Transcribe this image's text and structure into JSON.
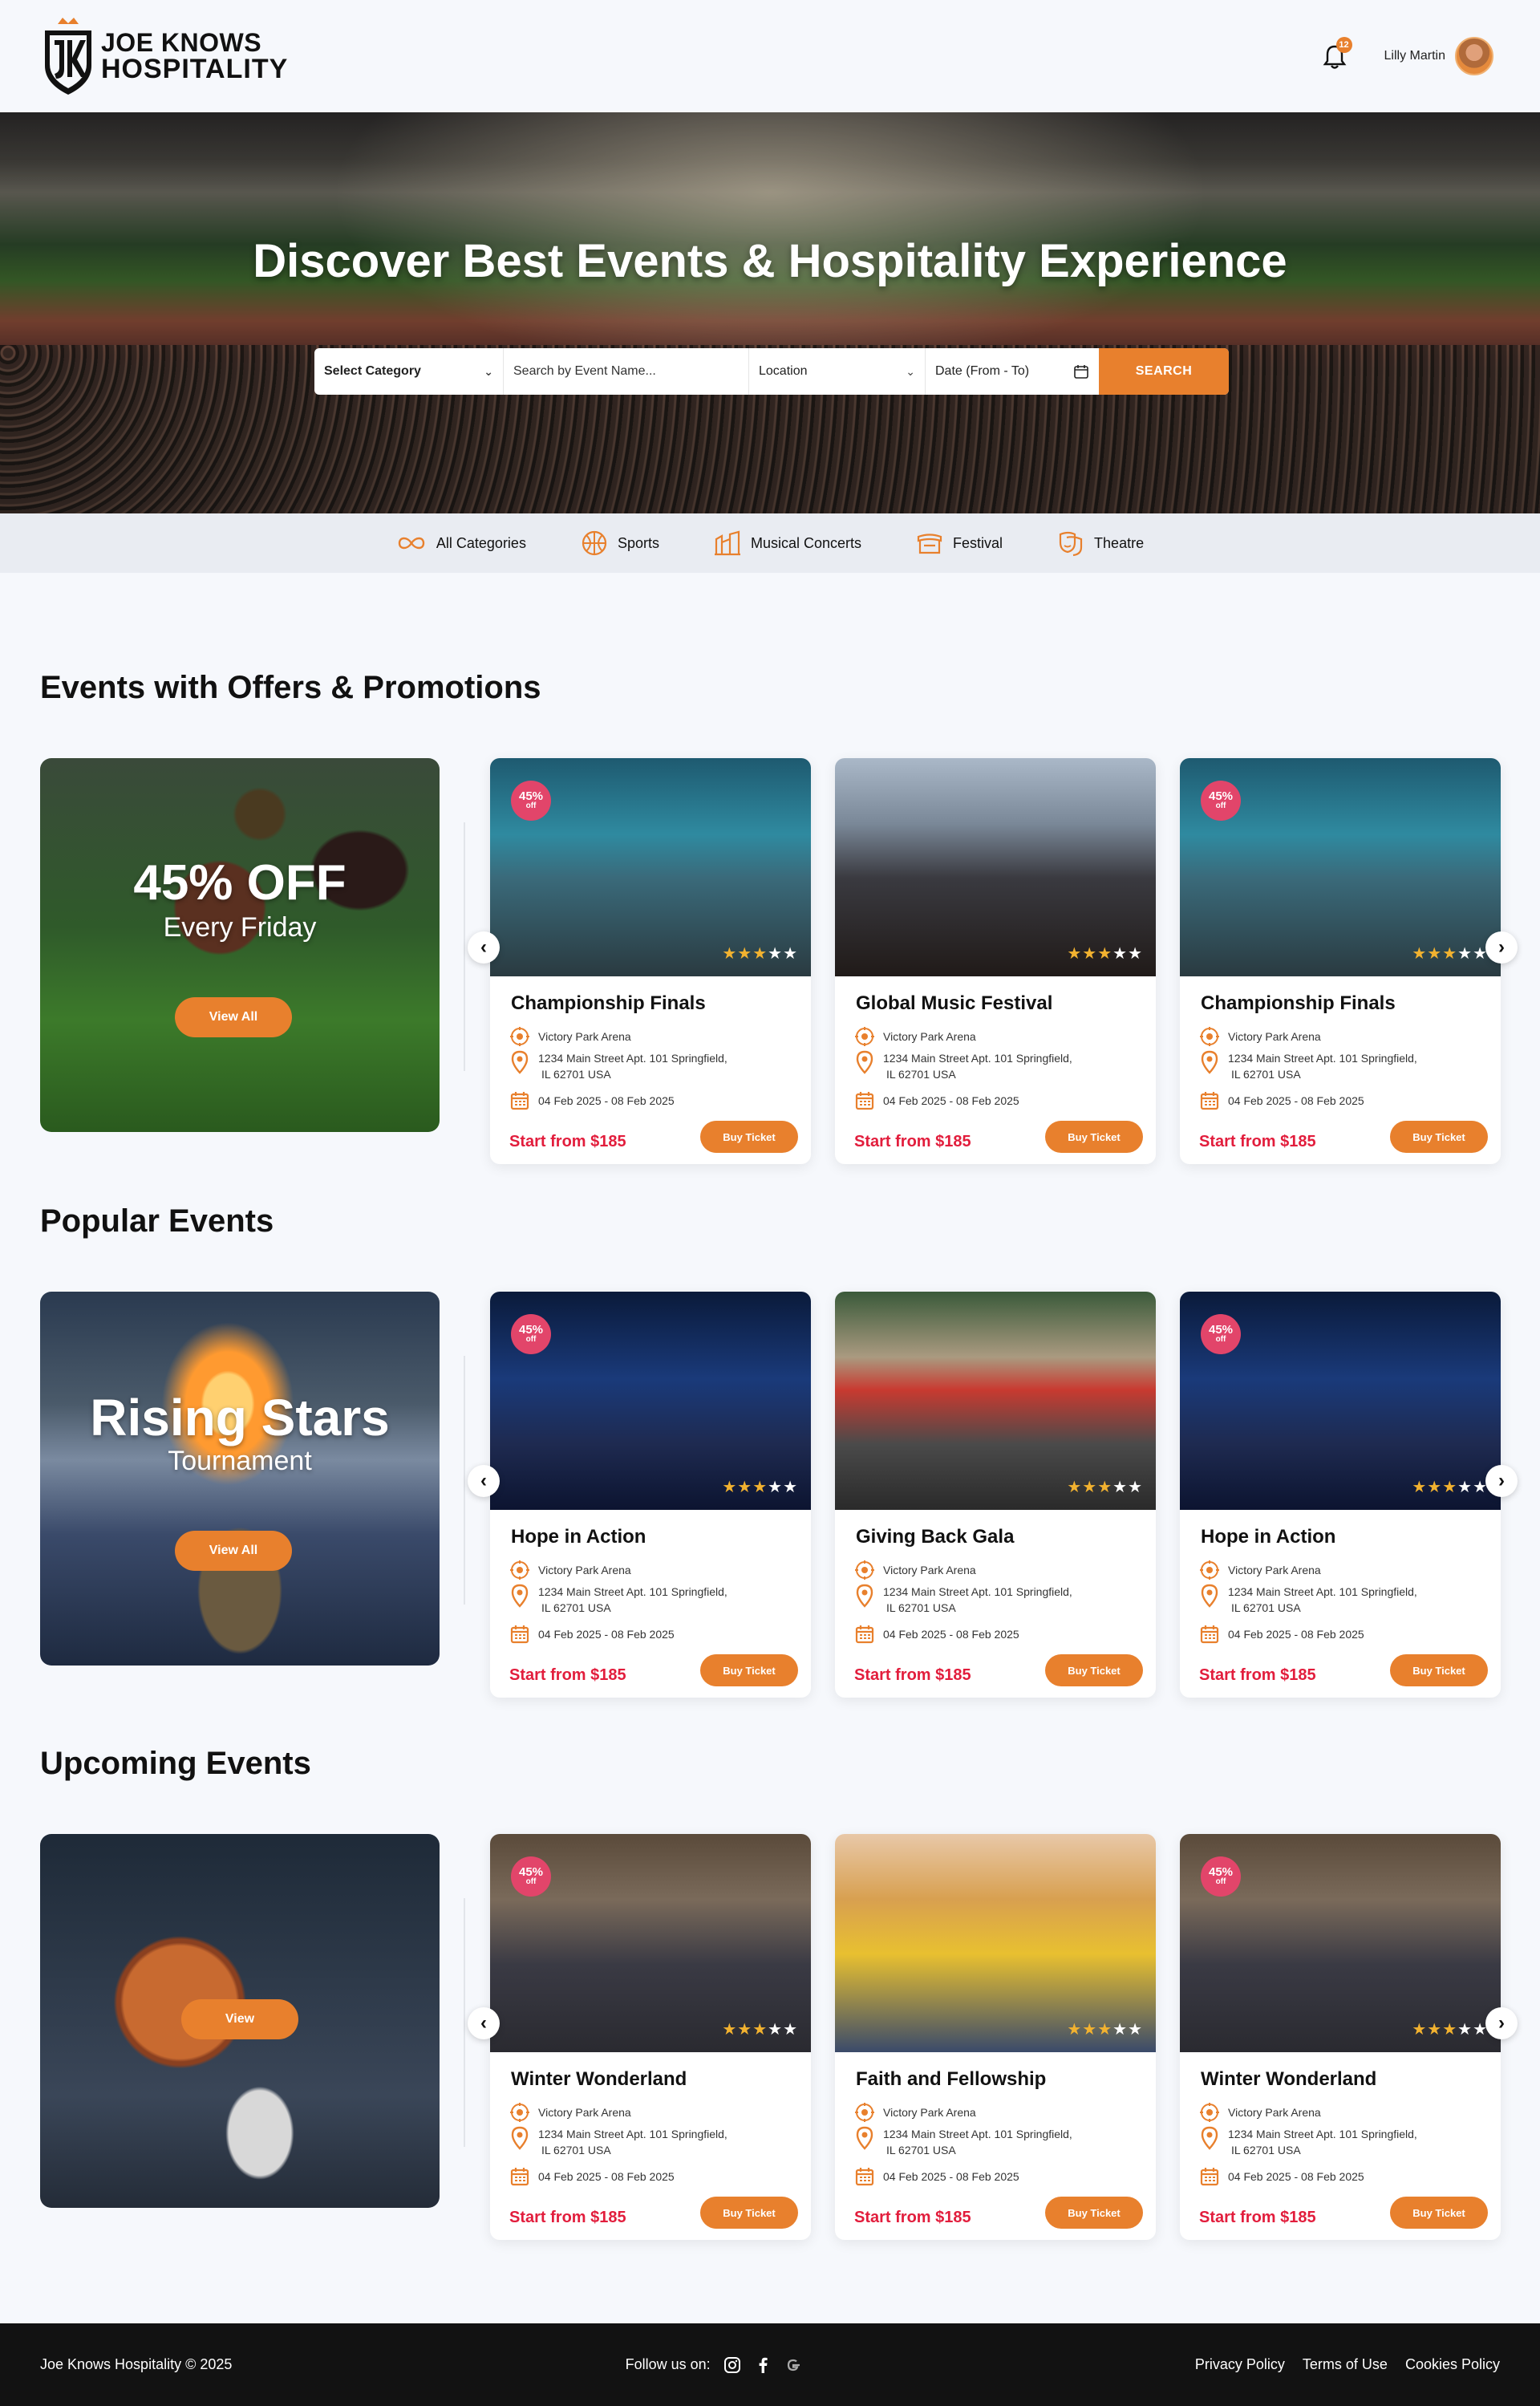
{
  "header": {
    "brand_line1": "JOE KNOWS",
    "brand_line2": "HOSPITALITY",
    "notification_count": "12",
    "user_name": "Lilly Martin"
  },
  "hero": {
    "title": "Discover Best Events & Hospitality Experience",
    "search": {
      "category": "Select Category",
      "event_name_placeholder": "Search by Event Name...",
      "location": "Location",
      "date": "Date (From - To)",
      "button": "SEARCH"
    }
  },
  "categories": [
    {
      "label": "All Categories",
      "icon": "infinity-icon"
    },
    {
      "label": "Sports",
      "icon": "ball-icon"
    },
    {
      "label": "Musical Concerts",
      "icon": "building-icon"
    },
    {
      "label": "Festival",
      "icon": "stage-icon"
    },
    {
      "label": "Theatre",
      "icon": "masks-icon"
    }
  ],
  "sections": [
    {
      "title": "Events with Offers & Promotions",
      "promo": {
        "big": "45% OFF",
        "small": "Every Friday",
        "button": "View All"
      },
      "cards": [
        {
          "title": "Championship Finals",
          "venue": "Victory Park Arena",
          "address1": "1234 Main Street Apt. 101 Springfield,",
          "address2": "IL 62701  USA",
          "dates": "04 Feb 2025 - 08 Feb 2025",
          "price": "Start from $185",
          "button": "Buy Ticket",
          "badge": "45%",
          "badge_sub": "off",
          "rating": 3
        },
        {
          "title": "Global Music Festival",
          "venue": "Victory Park Arena",
          "address1": "1234 Main Street Apt. 101 Springfield,",
          "address2": "IL 62701  USA",
          "dates": "04 Feb 2025 - 08 Feb 2025",
          "price": "Start from $185",
          "button": "Buy Ticket",
          "badge": "",
          "badge_sub": "",
          "rating": 3
        },
        {
          "title": "Championship Finals",
          "venue": "Victory Park Arena",
          "address1": "1234 Main Street Apt. 101 Springfield,",
          "address2": "IL 62701  USA",
          "dates": "04 Feb 2025 - 08 Feb 2025",
          "price": "Start from $185",
          "button": "Buy Ticket",
          "badge": "45%",
          "badge_sub": "off",
          "rating": 3
        }
      ]
    },
    {
      "title": "Popular Events",
      "promo": {
        "big": "Rising Stars",
        "small": "Tournament",
        "button": "View All"
      },
      "cards": [
        {
          "title": "Hope in Action",
          "venue": "Victory Park Arena",
          "address1": "1234 Main Street Apt. 101 Springfield,",
          "address2": "IL 62701  USA",
          "dates": "04 Feb 2025 - 08 Feb 2025",
          "price": "Start from $185",
          "button": "Buy Ticket",
          "badge": "45%",
          "badge_sub": "off",
          "rating": 3
        },
        {
          "title": "Giving Back Gala",
          "venue": "Victory Park Arena",
          "address1": "1234 Main Street Apt. 101 Springfield,",
          "address2": "IL 62701  USA",
          "dates": "04 Feb 2025 - 08 Feb 2025",
          "price": "Start from $185",
          "button": "Buy Ticket",
          "badge": "",
          "badge_sub": "",
          "rating": 3
        },
        {
          "title": "Hope in Action",
          "venue": "Victory Park Arena",
          "address1": "1234 Main Street Apt. 101 Springfield,",
          "address2": "IL 62701  USA",
          "dates": "04 Feb 2025 - 08 Feb 2025",
          "price": "Start from $185",
          "button": "Buy Ticket",
          "badge": "45%",
          "badge_sub": "off",
          "rating": 3
        }
      ]
    },
    {
      "title": "Upcoming Events",
      "promo": {
        "big": "",
        "small": "",
        "button": "View"
      },
      "cards": [
        {
          "title": "Winter Wonderland",
          "venue": "Victory Park Arena",
          "address1": "1234 Main Street Apt. 101 Springfield,",
          "address2": "IL 62701  USA",
          "dates": "04 Feb 2025 - 08 Feb 2025",
          "price": "Start from $185",
          "button": "Buy Ticket",
          "badge": "45%",
          "badge_sub": "off",
          "rating": 3
        },
        {
          "title": "Faith and Fellowship",
          "venue": "Victory Park Arena",
          "address1": "1234 Main Street Apt. 101 Springfield,",
          "address2": "IL 62701  USA",
          "dates": "04 Feb 2025 - 08 Feb 2025",
          "price": "Start from $185",
          "button": "Buy Ticket",
          "badge": "",
          "badge_sub": "",
          "rating": 3
        },
        {
          "title": "Winter Wonderland",
          "venue": "Victory Park Arena",
          "address1": "1234 Main Street Apt. 101 Springfield,",
          "address2": "IL 62701  USA",
          "dates": "04 Feb 2025 - 08 Feb 2025",
          "price": "Start from $185",
          "button": "Buy Ticket",
          "badge": "45%",
          "badge_sub": "off",
          "rating": 3
        }
      ]
    }
  ],
  "footer": {
    "copyright": "Joe Knows Hospitality © 2025",
    "follow": "Follow us on:",
    "social": [
      "instagram-icon",
      "facebook-icon",
      "google-icon"
    ],
    "links": [
      "Privacy Policy",
      "Terms of Use",
      "Cookies Policy"
    ]
  },
  "colors": {
    "accent": "#e8802d",
    "price": "#e21d3c",
    "badge": "#e2456a",
    "star": "#f2b230",
    "footer_bg": "#121212"
  }
}
